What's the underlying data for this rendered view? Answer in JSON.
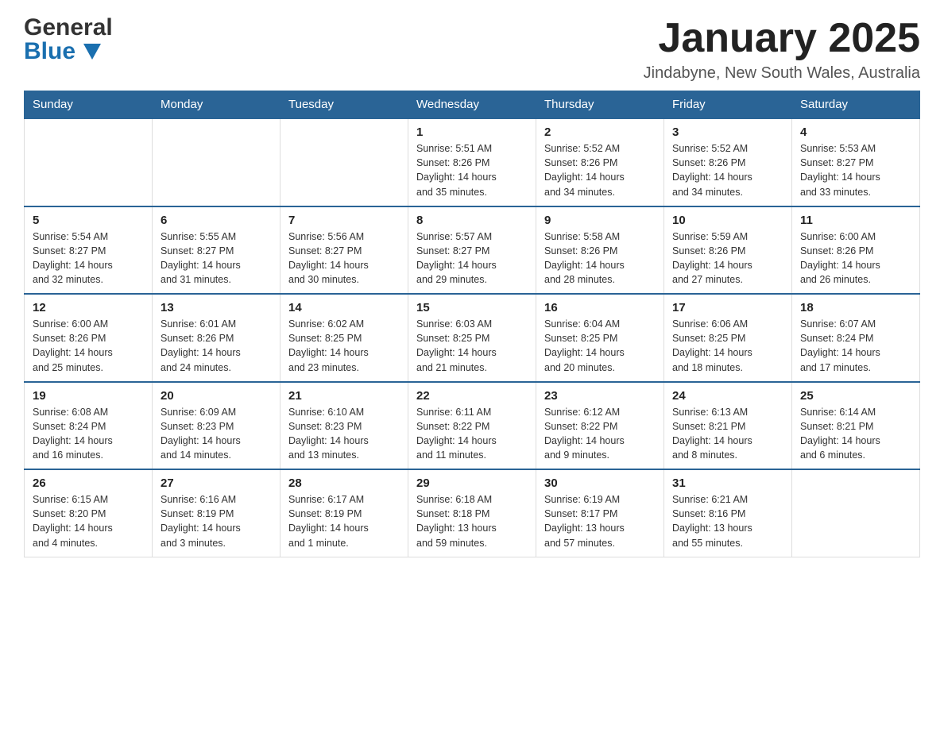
{
  "header": {
    "logo_general": "General",
    "logo_blue": "Blue",
    "month_title": "January 2025",
    "location": "Jindabyne, New South Wales, Australia"
  },
  "days_of_week": [
    "Sunday",
    "Monday",
    "Tuesday",
    "Wednesday",
    "Thursday",
    "Friday",
    "Saturday"
  ],
  "weeks": [
    {
      "days": [
        {
          "number": "",
          "info": ""
        },
        {
          "number": "",
          "info": ""
        },
        {
          "number": "",
          "info": ""
        },
        {
          "number": "1",
          "info": "Sunrise: 5:51 AM\nSunset: 8:26 PM\nDaylight: 14 hours\nand 35 minutes."
        },
        {
          "number": "2",
          "info": "Sunrise: 5:52 AM\nSunset: 8:26 PM\nDaylight: 14 hours\nand 34 minutes."
        },
        {
          "number": "3",
          "info": "Sunrise: 5:52 AM\nSunset: 8:26 PM\nDaylight: 14 hours\nand 34 minutes."
        },
        {
          "number": "4",
          "info": "Sunrise: 5:53 AM\nSunset: 8:27 PM\nDaylight: 14 hours\nand 33 minutes."
        }
      ]
    },
    {
      "days": [
        {
          "number": "5",
          "info": "Sunrise: 5:54 AM\nSunset: 8:27 PM\nDaylight: 14 hours\nand 32 minutes."
        },
        {
          "number": "6",
          "info": "Sunrise: 5:55 AM\nSunset: 8:27 PM\nDaylight: 14 hours\nand 31 minutes."
        },
        {
          "number": "7",
          "info": "Sunrise: 5:56 AM\nSunset: 8:27 PM\nDaylight: 14 hours\nand 30 minutes."
        },
        {
          "number": "8",
          "info": "Sunrise: 5:57 AM\nSunset: 8:27 PM\nDaylight: 14 hours\nand 29 minutes."
        },
        {
          "number": "9",
          "info": "Sunrise: 5:58 AM\nSunset: 8:26 PM\nDaylight: 14 hours\nand 28 minutes."
        },
        {
          "number": "10",
          "info": "Sunrise: 5:59 AM\nSunset: 8:26 PM\nDaylight: 14 hours\nand 27 minutes."
        },
        {
          "number": "11",
          "info": "Sunrise: 6:00 AM\nSunset: 8:26 PM\nDaylight: 14 hours\nand 26 minutes."
        }
      ]
    },
    {
      "days": [
        {
          "number": "12",
          "info": "Sunrise: 6:00 AM\nSunset: 8:26 PM\nDaylight: 14 hours\nand 25 minutes."
        },
        {
          "number": "13",
          "info": "Sunrise: 6:01 AM\nSunset: 8:26 PM\nDaylight: 14 hours\nand 24 minutes."
        },
        {
          "number": "14",
          "info": "Sunrise: 6:02 AM\nSunset: 8:25 PM\nDaylight: 14 hours\nand 23 minutes."
        },
        {
          "number": "15",
          "info": "Sunrise: 6:03 AM\nSunset: 8:25 PM\nDaylight: 14 hours\nand 21 minutes."
        },
        {
          "number": "16",
          "info": "Sunrise: 6:04 AM\nSunset: 8:25 PM\nDaylight: 14 hours\nand 20 minutes."
        },
        {
          "number": "17",
          "info": "Sunrise: 6:06 AM\nSunset: 8:25 PM\nDaylight: 14 hours\nand 18 minutes."
        },
        {
          "number": "18",
          "info": "Sunrise: 6:07 AM\nSunset: 8:24 PM\nDaylight: 14 hours\nand 17 minutes."
        }
      ]
    },
    {
      "days": [
        {
          "number": "19",
          "info": "Sunrise: 6:08 AM\nSunset: 8:24 PM\nDaylight: 14 hours\nand 16 minutes."
        },
        {
          "number": "20",
          "info": "Sunrise: 6:09 AM\nSunset: 8:23 PM\nDaylight: 14 hours\nand 14 minutes."
        },
        {
          "number": "21",
          "info": "Sunrise: 6:10 AM\nSunset: 8:23 PM\nDaylight: 14 hours\nand 13 minutes."
        },
        {
          "number": "22",
          "info": "Sunrise: 6:11 AM\nSunset: 8:22 PM\nDaylight: 14 hours\nand 11 minutes."
        },
        {
          "number": "23",
          "info": "Sunrise: 6:12 AM\nSunset: 8:22 PM\nDaylight: 14 hours\nand 9 minutes."
        },
        {
          "number": "24",
          "info": "Sunrise: 6:13 AM\nSunset: 8:21 PM\nDaylight: 14 hours\nand 8 minutes."
        },
        {
          "number": "25",
          "info": "Sunrise: 6:14 AM\nSunset: 8:21 PM\nDaylight: 14 hours\nand 6 minutes."
        }
      ]
    },
    {
      "days": [
        {
          "number": "26",
          "info": "Sunrise: 6:15 AM\nSunset: 8:20 PM\nDaylight: 14 hours\nand 4 minutes."
        },
        {
          "number": "27",
          "info": "Sunrise: 6:16 AM\nSunset: 8:19 PM\nDaylight: 14 hours\nand 3 minutes."
        },
        {
          "number": "28",
          "info": "Sunrise: 6:17 AM\nSunset: 8:19 PM\nDaylight: 14 hours\nand 1 minute."
        },
        {
          "number": "29",
          "info": "Sunrise: 6:18 AM\nSunset: 8:18 PM\nDaylight: 13 hours\nand 59 minutes."
        },
        {
          "number": "30",
          "info": "Sunrise: 6:19 AM\nSunset: 8:17 PM\nDaylight: 13 hours\nand 57 minutes."
        },
        {
          "number": "31",
          "info": "Sunrise: 6:21 AM\nSunset: 8:16 PM\nDaylight: 13 hours\nand 55 minutes."
        },
        {
          "number": "",
          "info": ""
        }
      ]
    }
  ]
}
